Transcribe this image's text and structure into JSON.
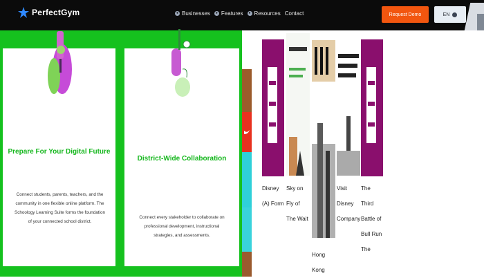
{
  "header": {
    "logo_text": "PerfectGym",
    "nav": [
      {
        "label": "Businesses",
        "icon": "circle-icon"
      },
      {
        "label": "Features",
        "icon": "circle-icon"
      },
      {
        "label": "Resources",
        "icon": "circle-icon"
      },
      {
        "label": "Contact"
      }
    ],
    "demo_label": "Request Demo",
    "lang_label": "EN",
    "colors": {
      "bg": "#0b0b0b",
      "demo": "#f2560f"
    }
  },
  "cards": [
    {
      "title": "Prepare For Your Digital Future",
      "body": "Connect students, parents, teachers, and the community in one flexible online platform. The Schoology Learning Suite forms the foundation of your connected school district."
    },
    {
      "title": "District-Wide Collaboration",
      "body": "Connect every stakeholder to collaborate on professional development, instructional strategies, and assessments."
    }
  ],
  "books": [
    {
      "caption": "Disney (A) Form"
    },
    {
      "caption": "Sky on Fly of The Wait"
    },
    {
      "caption": "Hong Kong"
    },
    {
      "caption": "Visit Disney Company"
    },
    {
      "caption": "The Third Battle of Bull Run The"
    }
  ],
  "colors": {
    "green": "#15c11e",
    "purple": "#8a0f6d"
  }
}
